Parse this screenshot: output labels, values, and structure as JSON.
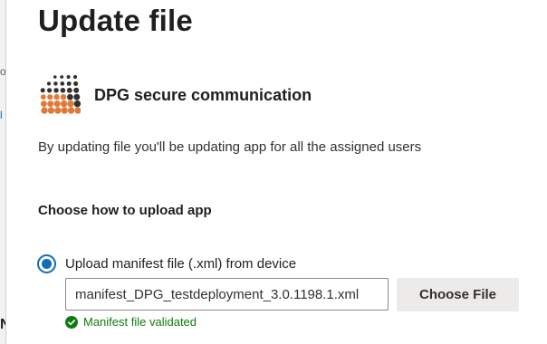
{
  "dialog": {
    "title": "Update file",
    "app_name": "DPG secure communication",
    "app_logo_icon": "dpg-dot-grid-logo",
    "description": "By updating file you'll be updating app for all the assigned users",
    "upload_section": {
      "heading": "Choose how to upload app",
      "option_label": "Upload manifest file (.xml) from device",
      "option_selected": true,
      "file_name": "manifest_DPG_testdeployment_3.0.1198.1.xml",
      "choose_button_label": "Choose File",
      "validation_message": "Manifest file validated",
      "validation_icon": "check-circle-icon"
    }
  },
  "colors": {
    "accent": "#0f6cbd",
    "success": "#107c10",
    "logo_dark": "#323130",
    "logo_orange": "#e07a3a"
  }
}
